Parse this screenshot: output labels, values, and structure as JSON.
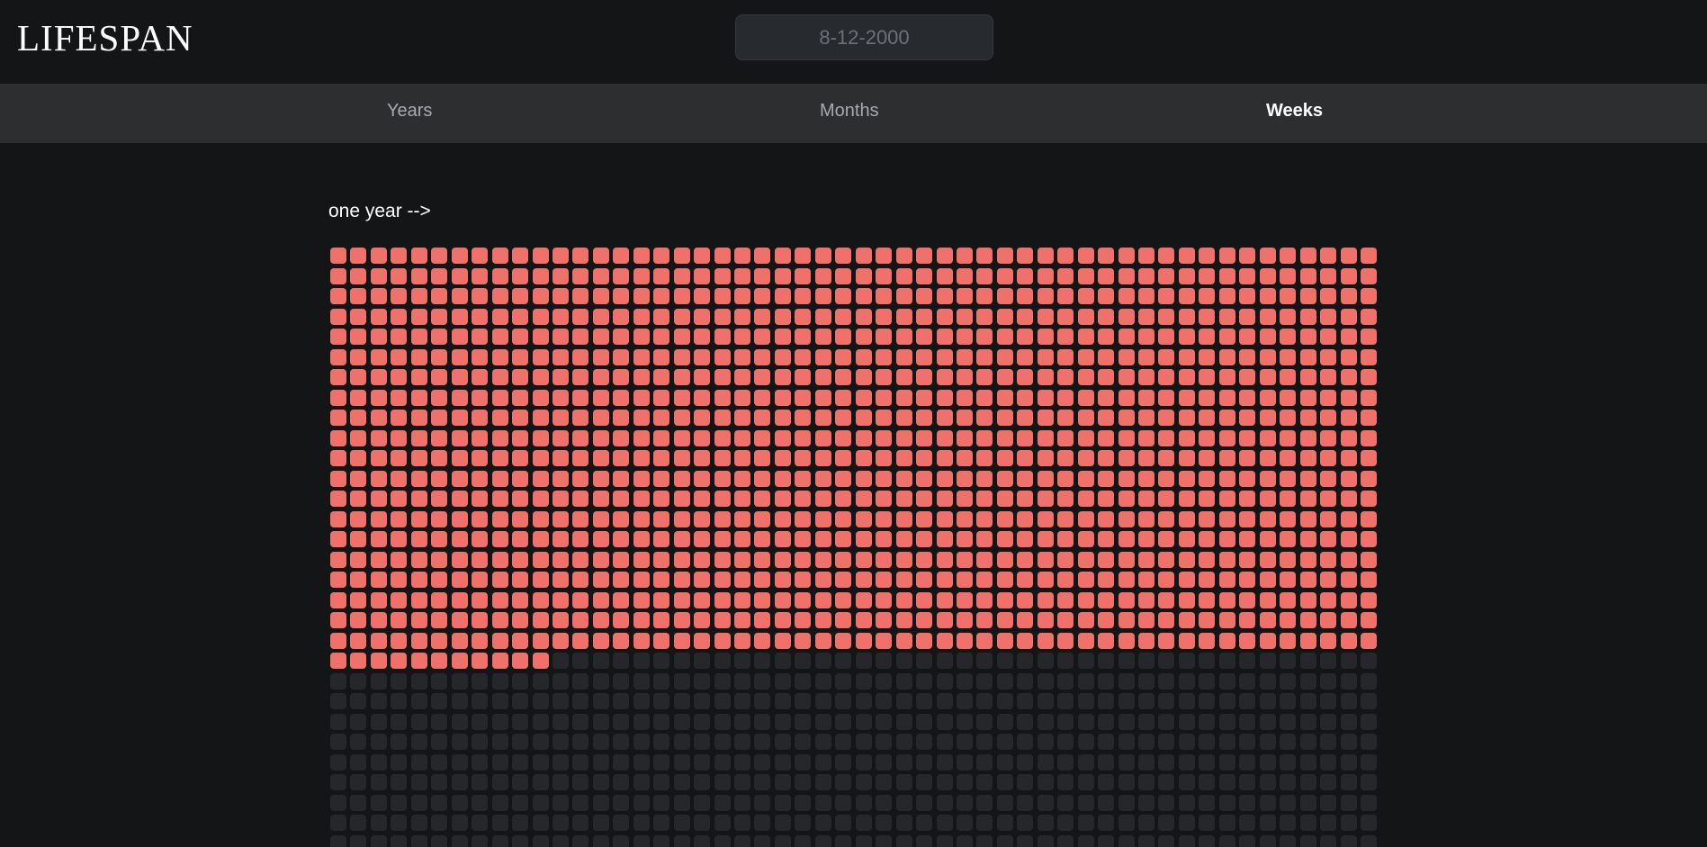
{
  "header": {
    "logo": "LIFESPAN",
    "date_placeholder": "8-12-2000"
  },
  "tabs": [
    {
      "label": "Years",
      "active": false
    },
    {
      "label": "Months",
      "active": false
    },
    {
      "label": "Weeks",
      "active": true
    }
  ],
  "main": {
    "caption": "one year -->"
  },
  "life_grid": {
    "unit": "weeks",
    "weeks_per_row": 52,
    "weeks_lived": 1051,
    "colors": {
      "lived": "#f0706a",
      "remaining": "#26272a"
    }
  }
}
